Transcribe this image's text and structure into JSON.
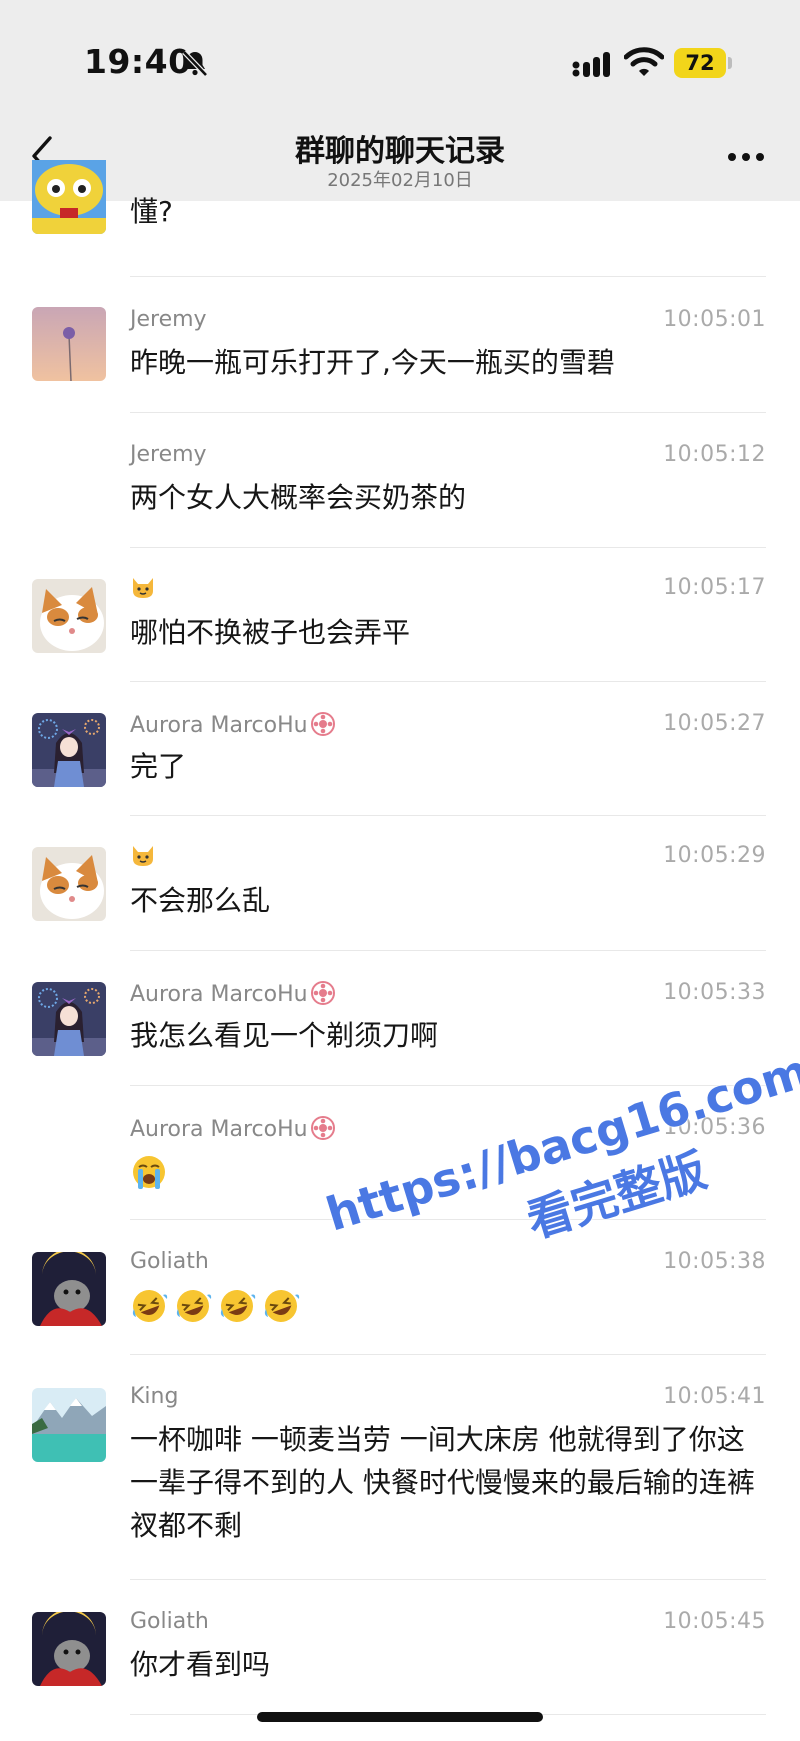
{
  "status_bar": {
    "time": "19:40",
    "battery": "72"
  },
  "nav": {
    "title": "群聊的聊天记录",
    "subtitle": "2025年02月10日"
  },
  "messages": [
    {
      "sender": "",
      "time": "",
      "text": "懂?"
    },
    {
      "sender": "Jeremy",
      "time": "10:05:01",
      "text": "昨晚一瓶可乐打开了,今天一瓶买的雪碧"
    },
    {
      "sender": "Jeremy",
      "time": "10:05:12",
      "text": "两个女人大概率会买奶茶的"
    },
    {
      "sender": "",
      "time": "10:05:17",
      "text": "哪怕不换被子也会弄平"
    },
    {
      "sender": "Aurora MarcoHu",
      "time": "10:05:27",
      "text": "完了"
    },
    {
      "sender": "",
      "time": "10:05:29",
      "text": "不会那么乱"
    },
    {
      "sender": "Aurora MarcoHu",
      "time": "10:05:33",
      "text": "我怎么看见一个剃须刀啊"
    },
    {
      "sender": "Aurora MarcoHu",
      "time": "10:05:36",
      "text": ""
    },
    {
      "sender": "Goliath",
      "time": "10:05:38",
      "text": ""
    },
    {
      "sender": "King",
      "time": "10:05:41",
      "text": "一杯咖啡 一顿麦当劳 一间大床房 他就得到了你这一辈子得不到的人 快餐时代慢慢来的最后输的连裤衩都不剩"
    },
    {
      "sender": "Goliath",
      "time": "10:05:45",
      "text": "你才看到吗"
    }
  ],
  "icons": {
    "cat_sender": "cat-emoji-icon",
    "badge": "flower-badge-icon",
    "cry": "loudly-crying-face-icon",
    "laugh": "rolling-laughing-face-icon"
  },
  "watermark": {
    "line1": "https://bacg16.com",
    "line2": "看完整版"
  },
  "colors": {
    "topbar": "#ededed",
    "watermark": "#4a78e3",
    "battery": "#f2d51a"
  }
}
